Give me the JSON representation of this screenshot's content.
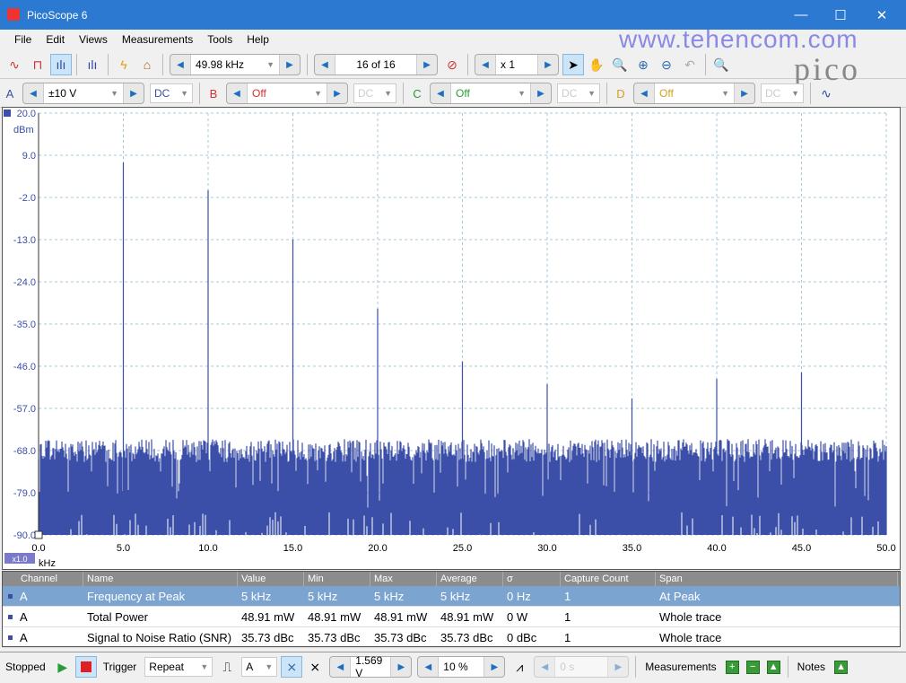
{
  "window": {
    "title": "PicoScope 6",
    "min": "—",
    "max": "☐",
    "close": "✕"
  },
  "watermark": "www.tehencom.com",
  "logo": "pico",
  "menu": [
    "File",
    "Edit",
    "Views",
    "Measurements",
    "Tools",
    "Help"
  ],
  "toolbar1": {
    "timebase": "49.98 kHz",
    "buffer": "16 of 16",
    "zoom": "x 1"
  },
  "channels": [
    {
      "label": "A",
      "color": "#3b4fa8",
      "range": "±10 V",
      "coupling": "DC"
    },
    {
      "label": "B",
      "color": "#d03030",
      "range": "Off",
      "coupling": "DC"
    },
    {
      "label": "C",
      "color": "#2a9a3a",
      "range": "Off",
      "coupling": "DC"
    },
    {
      "label": "D",
      "color": "#d0a020",
      "range": "Off",
      "coupling": "DC"
    }
  ],
  "chart_data": {
    "type": "area",
    "title": "",
    "ylabel": "dBm",
    "xlabel": "kHz",
    "ylim": [
      -90,
      20
    ],
    "xlim": [
      0,
      50
    ],
    "yticks": [
      "20.0",
      "9.0",
      "-2.0",
      "-13.0",
      "-24.0",
      "-35.0",
      "-46.0",
      "-57.0",
      "-68.0",
      "-79.0",
      "-90.0"
    ],
    "xticks": [
      "0.0",
      "5.0",
      "10.0",
      "15.0",
      "20.0",
      "25.0",
      "30.0",
      "35.0",
      "40.0",
      "45.0",
      "50.0"
    ],
    "grid": true,
    "noise_floor_dbm": -68,
    "peaks": [
      {
        "x": 5,
        "y": 7.1
      },
      {
        "x": 10,
        "y": -0.1
      },
      {
        "x": 15,
        "y": -13
      },
      {
        "x": 20,
        "y": -31
      },
      {
        "x": 25,
        "y": -44.8
      },
      {
        "x": 30,
        "y": -50.7
      },
      {
        "x": 35,
        "y": -54.4
      },
      {
        "x": 40,
        "y": -49.3
      },
      {
        "x": 45,
        "y": -47.6
      }
    ],
    "color": "#3b4fa8",
    "zoom_badge": "x1.0"
  },
  "table": {
    "headers": [
      "Channel",
      "Name",
      "Value",
      "Min",
      "Max",
      "Average",
      "σ",
      "Capture Count",
      "Span"
    ],
    "rows": [
      [
        "A",
        "Frequency at Peak",
        "5 kHz",
        "5 kHz",
        "5 kHz",
        "5 kHz",
        "0 Hz",
        "1",
        "At Peak"
      ],
      [
        "A",
        "Total Power",
        "48.91 mW",
        "48.91 mW",
        "48.91 mW",
        "48.91 mW",
        "0 W",
        "1",
        "Whole trace"
      ],
      [
        "A",
        "Signal to Noise Ratio (SNR)",
        "35.73 dBc",
        "35.73 dBc",
        "35.73 dBc",
        "35.73 dBc",
        "0 dBc",
        "1",
        "Whole trace"
      ]
    ]
  },
  "status": {
    "state": "Stopped",
    "trigger_label": "Trigger",
    "trigger_mode": "Repeat",
    "trigger_channel": "A",
    "threshold": "1.569 V",
    "pretrigger": "10 %",
    "delay": "0 s",
    "measurements_label": "Measurements",
    "notes_label": "Notes"
  }
}
